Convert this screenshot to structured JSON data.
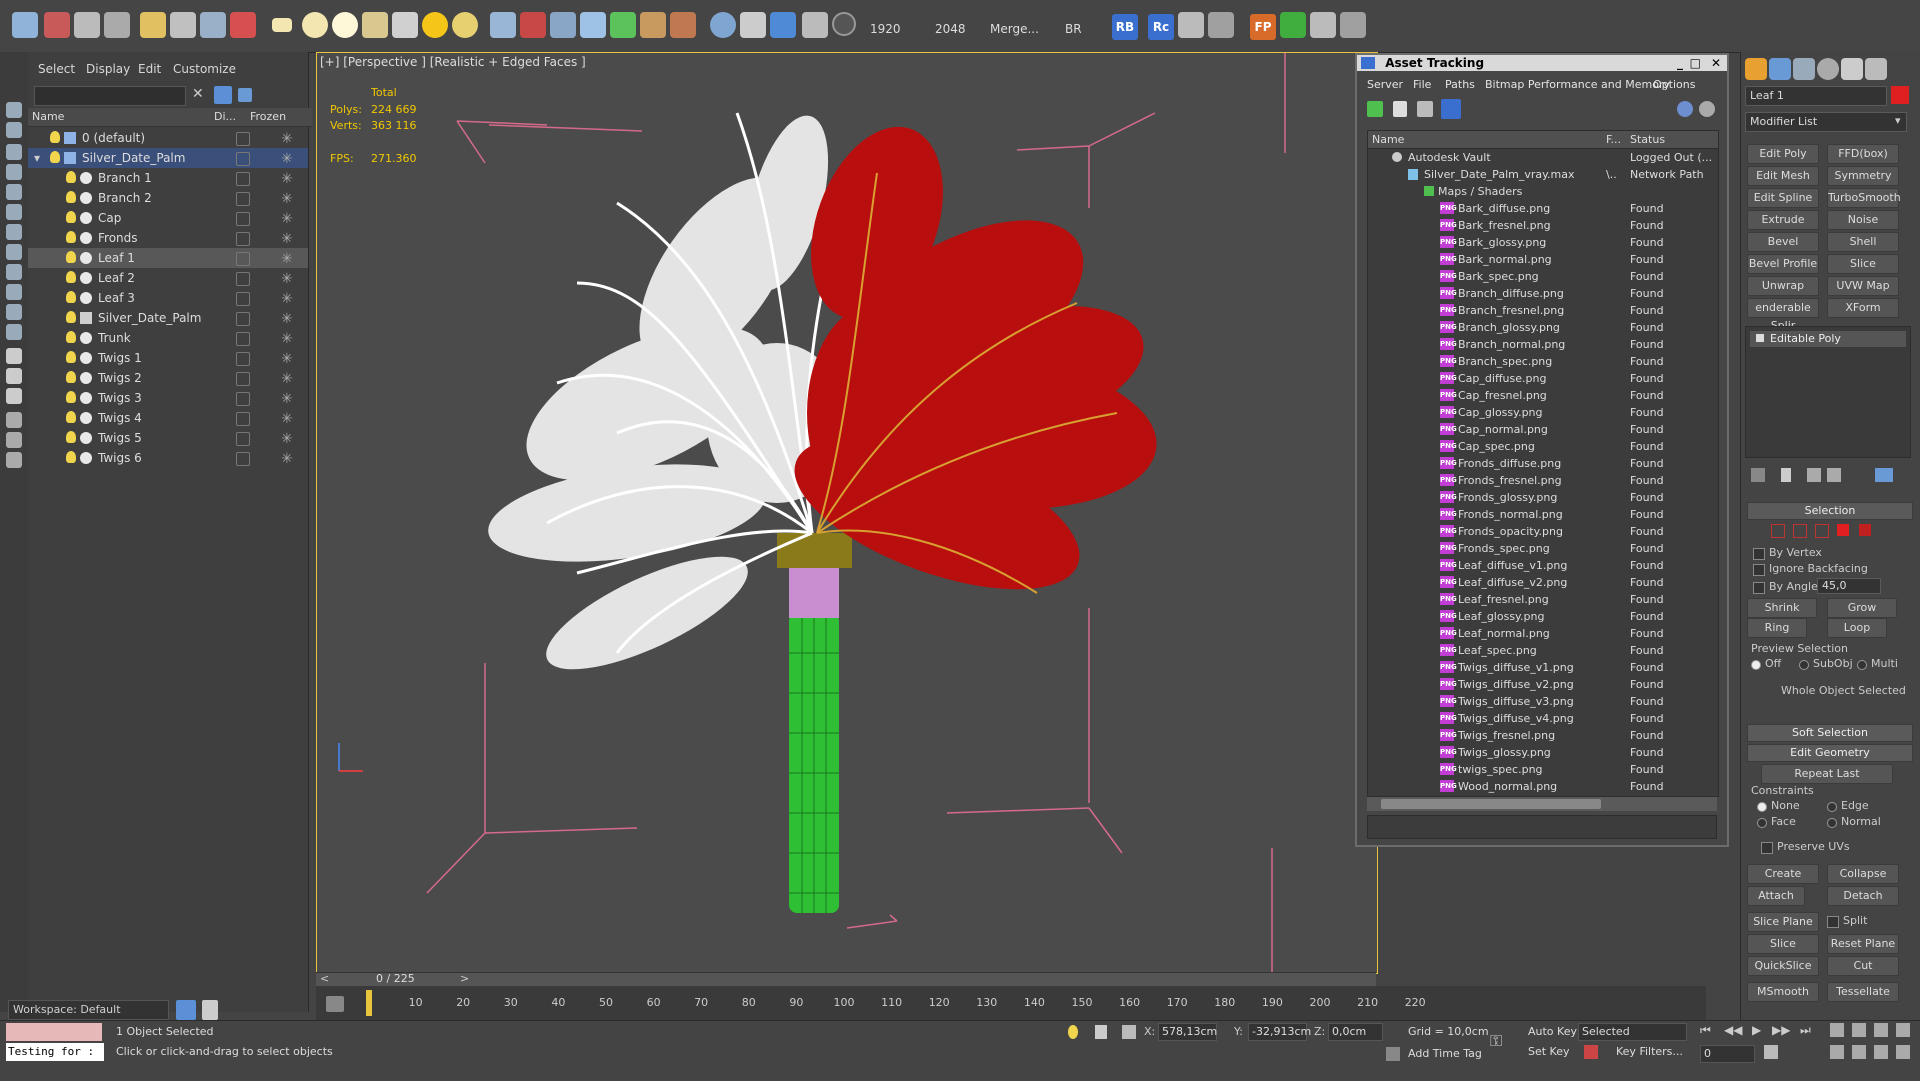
{
  "toolbar": {
    "render_width": "1920",
    "render_height": "2048",
    "merge_label": "Merge...",
    "br_label": "BR",
    "rb_label": "RB",
    "rc_label": "Rc",
    "fp_label": "FP"
  },
  "explorer": {
    "menu": [
      "Select",
      "Display",
      "Edit",
      "Customize"
    ],
    "columns": {
      "name": "Name",
      "display": "Di...",
      "frozen": "Frozen"
    },
    "rows": [
      {
        "label": "0 (default)"
      },
      {
        "label": "Silver_Date_Palm"
      },
      {
        "label": "Branch 1"
      },
      {
        "label": "Branch 2"
      },
      {
        "label": "Cap"
      },
      {
        "label": "Fronds"
      },
      {
        "label": "Leaf 1"
      },
      {
        "label": "Leaf 2"
      },
      {
        "label": "Leaf 3"
      },
      {
        "label": "Silver_Date_Palm"
      },
      {
        "label": "Trunk"
      },
      {
        "label": "Twigs 1"
      },
      {
        "label": "Twigs 2"
      },
      {
        "label": "Twigs 3"
      },
      {
        "label": "Twigs 4"
      },
      {
        "label": "Twigs 5"
      },
      {
        "label": "Twigs 6"
      }
    ],
    "workspace": "Workspace: Default"
  },
  "viewport": {
    "label": "[+] [Perspective ] [Realistic + Edged Faces ]",
    "stats": {
      "total_label": "Total",
      "polys_label": "Polys:",
      "polys_value": "224 669",
      "verts_label": "Verts:",
      "verts_value": "363 116",
      "fps_label": "FPS:",
      "fps_value": "271.360"
    }
  },
  "timeline": {
    "slider_text": "0 / 225",
    "ticks": [
      "10",
      "20",
      "30",
      "40",
      "50",
      "60",
      "70",
      "80",
      "90",
      "100",
      "110",
      "120",
      "130",
      "140",
      "150",
      "160",
      "170",
      "180",
      "190",
      "200",
      "210",
      "220"
    ]
  },
  "asset_tracking": {
    "title": "Asset Tracking",
    "menu": [
      "Server",
      "File",
      "Paths",
      "Bitmap Performance and Memory",
      "Options"
    ],
    "columns": {
      "name": "Name",
      "path": "F...",
      "status": "Status"
    },
    "vault": {
      "name": "Autodesk Vault",
      "status": "Logged Out (..."
    },
    "max_file": {
      "name": "Silver_Date_Palm_vray.max",
      "path": "\\..",
      "status": "Network Path"
    },
    "maps_folder": "Maps / Shaders",
    "files": [
      {
        "name": "Bark_diffuse.png",
        "status": "Found"
      },
      {
        "name": "Bark_fresnel.png",
        "status": "Found"
      },
      {
        "name": "Bark_glossy.png",
        "status": "Found"
      },
      {
        "name": "Bark_normal.png",
        "status": "Found"
      },
      {
        "name": "Bark_spec.png",
        "status": "Found"
      },
      {
        "name": "Branch_diffuse.png",
        "status": "Found"
      },
      {
        "name": "Branch_fresnel.png",
        "status": "Found"
      },
      {
        "name": "Branch_glossy.png",
        "status": "Found"
      },
      {
        "name": "Branch_normal.png",
        "status": "Found"
      },
      {
        "name": "Branch_spec.png",
        "status": "Found"
      },
      {
        "name": "Cap_diffuse.png",
        "status": "Found"
      },
      {
        "name": "Cap_fresnel.png",
        "status": "Found"
      },
      {
        "name": "Cap_glossy.png",
        "status": "Found"
      },
      {
        "name": "Cap_normal.png",
        "status": "Found"
      },
      {
        "name": "Cap_spec.png",
        "status": "Found"
      },
      {
        "name": "Fronds_diffuse.png",
        "status": "Found"
      },
      {
        "name": "Fronds_fresnel.png",
        "status": "Found"
      },
      {
        "name": "Fronds_glossy.png",
        "status": "Found"
      },
      {
        "name": "Fronds_normal.png",
        "status": "Found"
      },
      {
        "name": "Fronds_opacity.png",
        "status": "Found"
      },
      {
        "name": "Fronds_spec.png",
        "status": "Found"
      },
      {
        "name": "Leaf_diffuse_v1.png",
        "status": "Found"
      },
      {
        "name": "Leaf_diffuse_v2.png",
        "status": "Found"
      },
      {
        "name": "Leaf_fresnel.png",
        "status": "Found"
      },
      {
        "name": "Leaf_glossy.png",
        "status": "Found"
      },
      {
        "name": "Leaf_normal.png",
        "status": "Found"
      },
      {
        "name": "Leaf_spec.png",
        "status": "Found"
      },
      {
        "name": "Twigs_diffuse_v1.png",
        "status": "Found"
      },
      {
        "name": "Twigs_diffuse_v2.png",
        "status": "Found"
      },
      {
        "name": "Twigs_diffuse_v3.png",
        "status": "Found"
      },
      {
        "name": "Twigs_diffuse_v4.png",
        "status": "Found"
      },
      {
        "name": "Twigs_fresnel.png",
        "status": "Found"
      },
      {
        "name": "Twigs_glossy.png",
        "status": "Found"
      },
      {
        "name": "twigs_spec.png",
        "status": "Found"
      },
      {
        "name": "Wood_normal.png",
        "status": "Found"
      }
    ],
    "png_badge": "PNG"
  },
  "command_panel": {
    "object_name": "Leaf 1",
    "modifier_list": "Modifier List",
    "modifier_buttons": [
      [
        "Edit Poly",
        "FFD(box)"
      ],
      [
        "Edit Mesh",
        "Symmetry"
      ],
      [
        "Edit Spline",
        "TurboSmooth"
      ],
      [
        "Extrude",
        "Noise"
      ],
      [
        "Bevel",
        "Shell"
      ],
      [
        "Bevel Profile",
        "Slice"
      ],
      [
        "Unwrap UVW",
        "UVW Map"
      ],
      [
        "enderable Splir",
        "XForm"
      ]
    ],
    "stack_item": "Editable Poly",
    "selection": {
      "title": "Selection",
      "by_vertex": "By Vertex",
      "ignore_backfacing": "Ignore Backfacing",
      "by_angle": "By Angle:",
      "angle_value": "45,0",
      "shrink": "Shrink",
      "grow": "Grow",
      "ring": "Ring",
      "loop": "Loop",
      "preview_selection": "Preview Selection",
      "preview_options": [
        "Off",
        "SubObj",
        "Multi"
      ],
      "whole_object": "Whole Object Selected"
    },
    "soft_selection": "Soft Selection",
    "edit_geometry": {
      "title": "Edit Geometry",
      "repeat_last": "Repeat Last",
      "constraints": "Constraints",
      "options": [
        "None",
        "Edge",
        "Face",
        "Normal"
      ],
      "preserve_uvs": "Preserve UVs",
      "create": "Create",
      "collapse": "Collapse",
      "attach": "Attach",
      "detach": "Detach",
      "slice_plane": "Slice Plane",
      "split": "Split",
      "slice": "Slice",
      "reset_plane": "Reset Plane",
      "quickslice": "QuickSlice",
      "cut": "Cut",
      "msmooth": "MSmooth",
      "tessellate": "Tessellate"
    }
  },
  "statusbar": {
    "script_text": "Testing for :",
    "selected_text": "1 Object Selected",
    "prompt_text": "Click or click-and-drag to select objects",
    "x_label": "X:",
    "x_value": "578,13cm",
    "y_label": "Y:",
    "y_value": "-32,913cm",
    "z_label": "Z:",
    "z_value": "0,0cm",
    "grid": "Grid = 10,0cm",
    "add_time_tag": "Add Time Tag",
    "auto_key": "Auto Key",
    "set_key": "Set Key",
    "selected_dropdown": "Selected",
    "key_filters": "Key Filters...",
    "frame_value": "0"
  }
}
